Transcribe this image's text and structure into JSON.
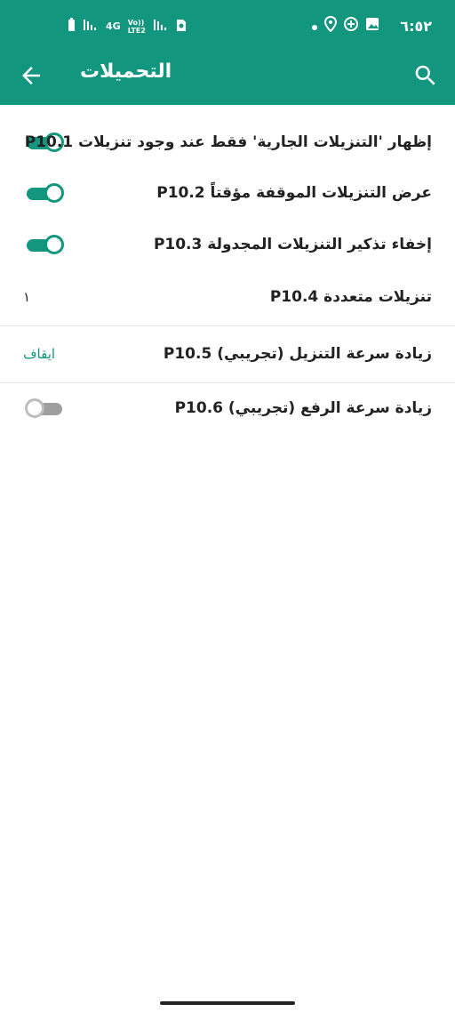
{
  "colors": {
    "accent": "#12967d",
    "bar_text": "#ffffff"
  },
  "status_bar": {
    "time": "٦:٥٢",
    "network_1": "4G",
    "network_2_top": "Vo))",
    "network_2_bottom": "LTE2"
  },
  "app_bar": {
    "title": "التحميلات",
    "back_icon": "arrow-left-icon",
    "search_icon": "search-icon"
  },
  "settings": [
    {
      "label": "إظهار 'التنزيلات الجارية' فقط عند وجود تنزيلات P10.1",
      "control": "switch",
      "on": true
    },
    {
      "label": "عرض التنزيلات الموقفة مؤقتاً P10.2",
      "control": "switch",
      "on": true
    },
    {
      "label": "إخفاء تذكير التنزيلات المجدولة P10.3",
      "control": "switch",
      "on": true
    },
    {
      "label": "تنزيلات متعددة P10.4",
      "control": "value",
      "value": "١"
    },
    {
      "label": "زيادة سرعة التنزيل (تجريبي) P10.5",
      "control": "value",
      "value": "ايقاف"
    },
    {
      "label": "زيادة سرعة الرفع (تجريبي) P10.6",
      "control": "switch",
      "on": false
    }
  ]
}
